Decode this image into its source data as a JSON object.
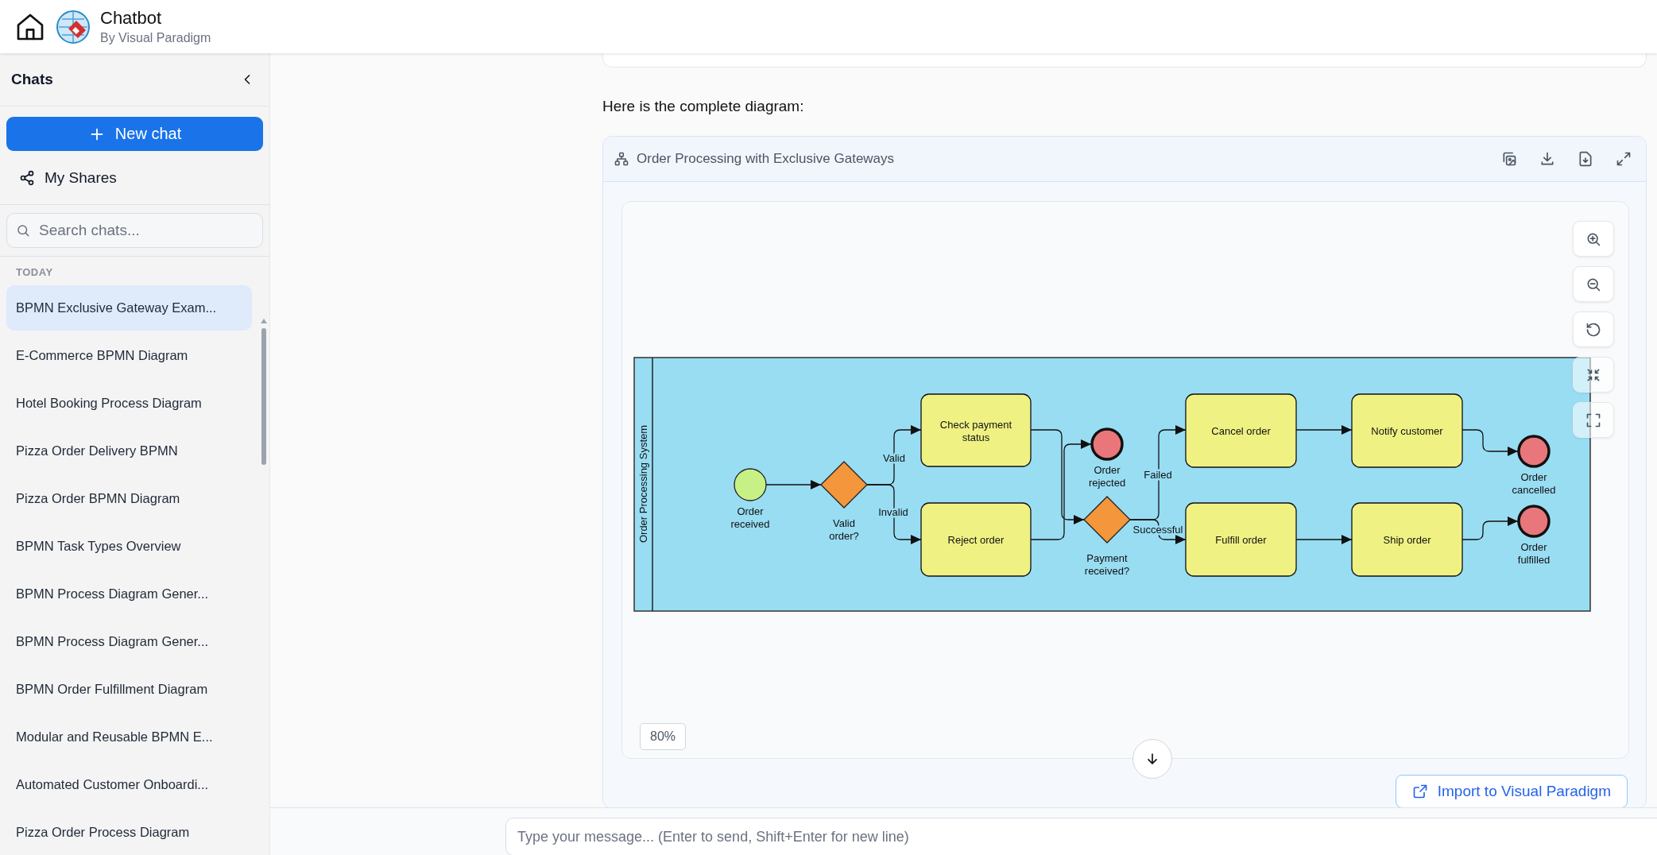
{
  "header": {
    "title": "Chatbot",
    "subtitle": "By Visual Paradigm"
  },
  "sidebar": {
    "title": "Chats",
    "new_chat": "New chat",
    "my_shares": "My Shares",
    "search": {
      "placeholder": "Search chats..."
    },
    "section": "TODAY",
    "items": [
      {
        "label": "BPMN Exclusive Gateway Exam...",
        "selected": true
      },
      {
        "label": "E-Commerce BPMN Diagram",
        "selected": false
      },
      {
        "label": "Hotel Booking Process Diagram",
        "selected": false
      },
      {
        "label": "Pizza Order Delivery BPMN",
        "selected": false
      },
      {
        "label": "Pizza Order BPMN Diagram",
        "selected": false
      },
      {
        "label": "BPMN Task Types Overview",
        "selected": false
      },
      {
        "label": "BPMN Process Diagram Gener...",
        "selected": false
      },
      {
        "label": "BPMN Process Diagram Gener...",
        "selected": false
      },
      {
        "label": "BPMN Order Fulfillment Diagram",
        "selected": false
      },
      {
        "label": "Modular and Reusable BPMN E...",
        "selected": false
      },
      {
        "label": "Automated Customer Onboardi...",
        "selected": false
      },
      {
        "label": "Pizza Order Process Diagram",
        "selected": false
      }
    ]
  },
  "message": {
    "intro": "Here is the complete diagram:",
    "diagram_card": {
      "title": "Order Processing with Exclusive Gateways",
      "zoom": "80%",
      "lane": "Order Processing System",
      "nodes": [
        {
          "kind": "start",
          "label": "Order received"
        },
        {
          "kind": "gateway",
          "label": "Valid order?"
        },
        {
          "kind": "task",
          "label": "Check payment status"
        },
        {
          "kind": "task",
          "label": "Reject order"
        },
        {
          "kind": "end",
          "label": "Order rejected"
        },
        {
          "kind": "gateway",
          "label": "Payment received?"
        },
        {
          "kind": "task",
          "label": "Cancel order"
        },
        {
          "kind": "task",
          "label": "Notify customer"
        },
        {
          "kind": "task",
          "label": "Fulfill order"
        },
        {
          "kind": "task",
          "label": "Ship order"
        },
        {
          "kind": "end",
          "label": "Order cancelled"
        },
        {
          "kind": "end",
          "label": "Order fulfilled"
        }
      ],
      "edge_labels": [
        "Valid",
        "Invalid",
        "Failed",
        "Successful"
      ]
    },
    "import_button": "Import to Visual Paradigm"
  },
  "composer": {
    "placeholder": "Type your message... (Enter to send, Shift+Enter for new line)"
  }
}
